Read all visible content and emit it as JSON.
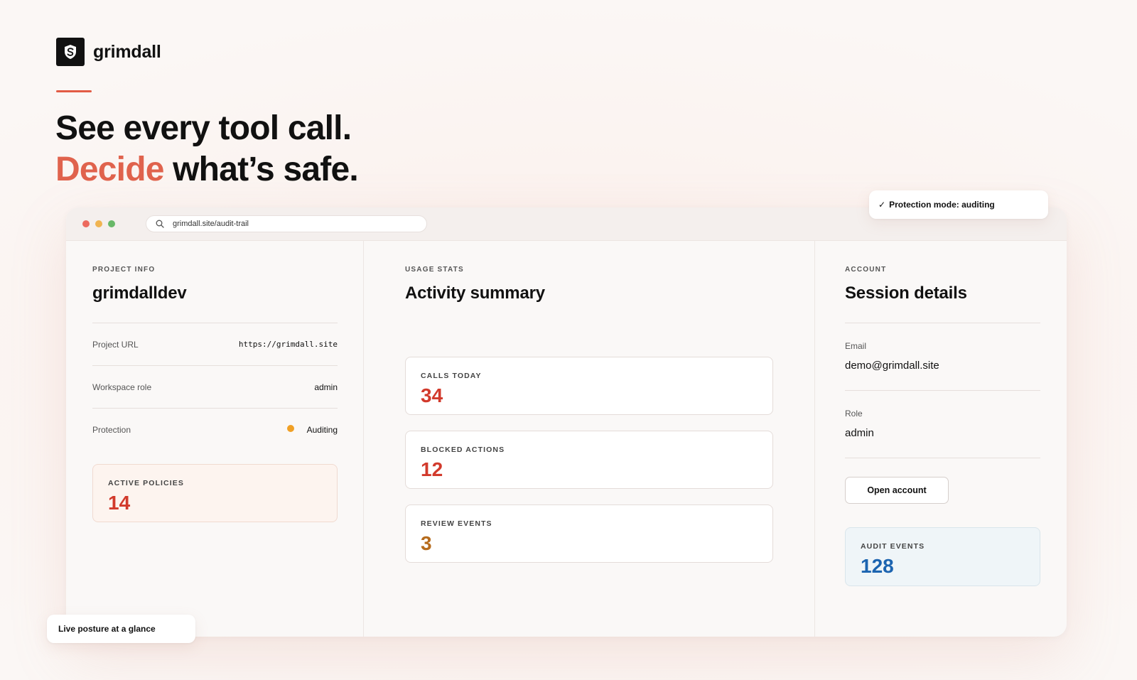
{
  "brand": {
    "name": "grimdall",
    "logo_icon": "shield-s-logo-icon"
  },
  "hero": {
    "line1": "See every tool call.",
    "accent": "Decide",
    "line2_rest": " what’s safe."
  },
  "colors": {
    "accent": "#e0634d",
    "red_stat": "#d23a2c",
    "amber_stat": "#b66b1c",
    "blue_stat": "#1c64b0",
    "status_dot": "#f0a025"
  },
  "browser": {
    "url": "grimdall.site/audit-trail",
    "search_icon": "search-icon"
  },
  "badges": {
    "protection_mode": "Protection mode: auditing",
    "protection_check": "✓",
    "live_posture": "Live posture at a glance"
  },
  "project": {
    "eyebrow": "PROJECT INFO",
    "name": "grimdalldev",
    "rows": [
      {
        "label": "Project URL",
        "value": "https://grimdall.site"
      },
      {
        "label": "Workspace role",
        "value": "admin"
      },
      {
        "label": "Protection",
        "value": "Auditing"
      }
    ],
    "active_policies": {
      "label": "ACTIVE POLICIES",
      "value": "14"
    }
  },
  "usage": {
    "eyebrow": "USAGE STATS",
    "title": "Activity summary",
    "stats": [
      {
        "label": "CALLS TODAY",
        "value": "34"
      },
      {
        "label": "BLOCKED ACTIONS",
        "value": "12"
      },
      {
        "label": "REVIEW EVENTS",
        "value": "3"
      }
    ]
  },
  "account": {
    "eyebrow": "ACCOUNT",
    "title": "Session details",
    "email_label": "Email",
    "email": "demo@grimdall.site",
    "role_label": "Role",
    "role": "admin",
    "open_button": "Open account",
    "audit_events": {
      "label": "AUDIT EVENTS",
      "value": "128"
    }
  }
}
